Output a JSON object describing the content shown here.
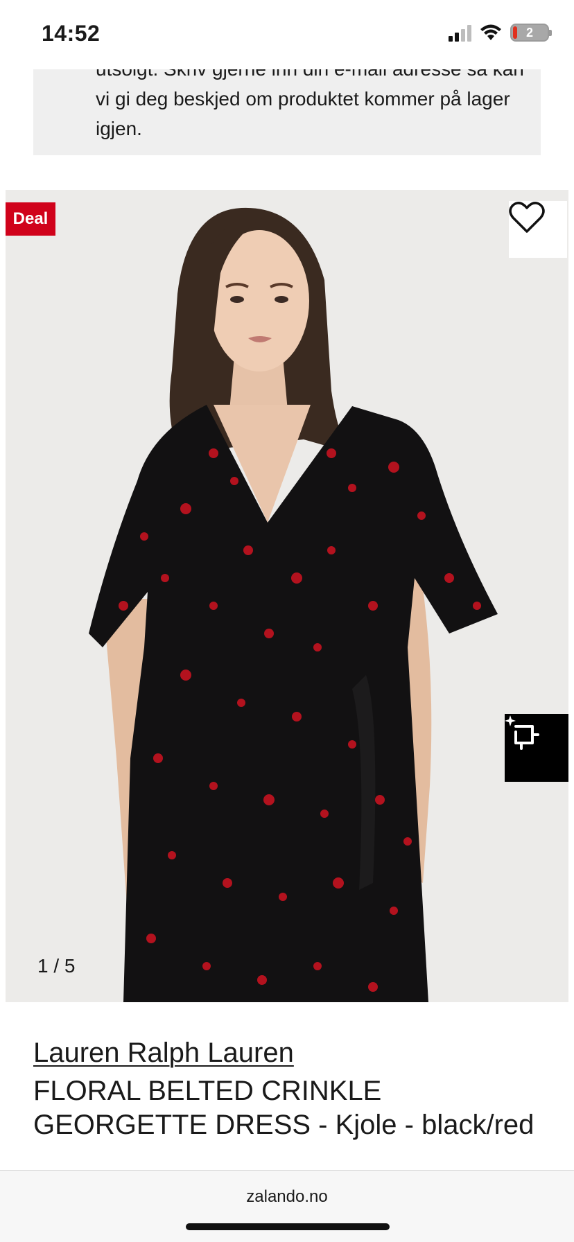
{
  "status_bar": {
    "time": "14:52",
    "battery_level": "2"
  },
  "notice": {
    "text": "utsolgt. Skriv gjerne inn din e-mail adresse så kan vi gi deg beskjed om produktet kommer på lager igjen."
  },
  "product_image": {
    "deal_label": "Deal",
    "counter": "1 / 5",
    "wishlist_icon": "heart-icon",
    "crop_icon": "crop-sparkle-icon"
  },
  "product": {
    "brand": "Lauren Ralph Lauren",
    "name": "FLORAL BELTED CRINKLE GEORGETTE DRESS - Kjole - black/red"
  },
  "browser": {
    "url": "zalando.no"
  },
  "colors": {
    "deal_red": "#d0021b",
    "dress_black": "#111111",
    "flower_red": "#b3121e"
  }
}
